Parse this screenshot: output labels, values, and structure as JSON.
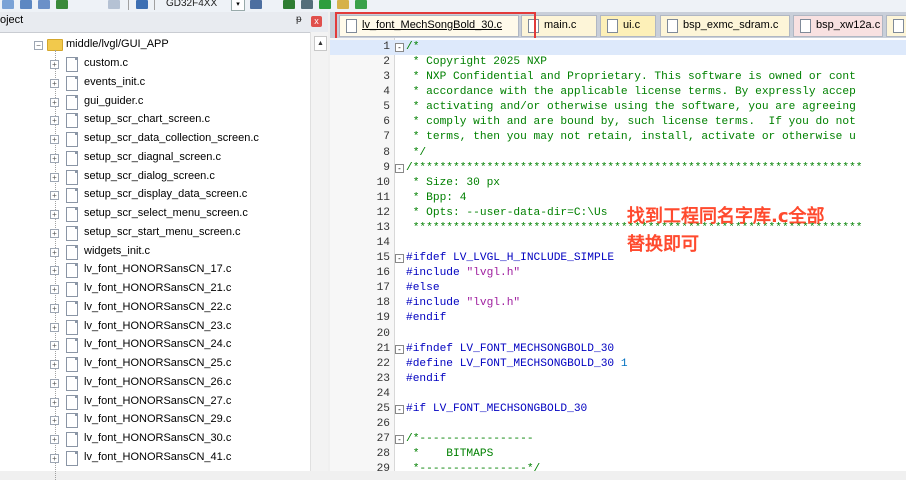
{
  "toolbar": {
    "device_combo": "GD32F4XX",
    "dropdown_arrow": "▾"
  },
  "project": {
    "title": "oject",
    "pin": "ᵽ",
    "close": "x",
    "folder_label": "middle/lvgl/GUI_APP",
    "files": [
      "custom.c",
      "events_init.c",
      "gui_guider.c",
      "setup_scr_chart_screen.c",
      "setup_scr_data_collection_screen.c",
      "setup_scr_diagnal_screen.c",
      "setup_scr_dialog_screen.c",
      "setup_scr_display_data_screen.c",
      "setup_scr_select_menu_screen.c",
      "setup_scr_start_menu_screen.c",
      "widgets_init.c",
      "lv_font_HONORSansCN_17.c",
      "lv_font_HONORSansCN_21.c",
      "lv_font_HONORSansCN_22.c",
      "lv_font_HONORSansCN_23.c",
      "lv_font_HONORSansCN_24.c",
      "lv_font_HONORSansCN_25.c",
      "lv_font_HONORSansCN_26.c",
      "lv_font_HONORSansCN_27.c",
      "lv_font_HONORSansCN_29.c",
      "lv_font_HONORSansCN_30.c",
      "lv_font_HONORSansCN_41.c"
    ]
  },
  "tabs": [
    {
      "label": "lv_font_MechSongBold_30.c",
      "active": true,
      "style": "active"
    },
    {
      "label": "main.c",
      "active": false,
      "style": "plain"
    },
    {
      "label": "ui.c",
      "active": false,
      "style": "yellow"
    },
    {
      "label": "bsp_exmc_sdram.c",
      "active": false,
      "style": "plain"
    },
    {
      "label": "bsp_xw12a.c",
      "active": false,
      "style": "pink"
    }
  ],
  "editor": {
    "lines": [
      {
        "n": "1",
        "fold": "-",
        "kind": "comment",
        "text": "/*"
      },
      {
        "n": "2",
        "fold": "",
        "kind": "comment",
        "text": " * Copyright 2025 NXP"
      },
      {
        "n": "3",
        "fold": "",
        "kind": "comment",
        "text": " * NXP Confidential and Proprietary. This software is owned or cont"
      },
      {
        "n": "4",
        "fold": "",
        "kind": "comment",
        "text": " * accordance with the applicable license terms. By expressly accep"
      },
      {
        "n": "5",
        "fold": "",
        "kind": "comment",
        "text": " * activating and/or otherwise using the software, you are agreeing"
      },
      {
        "n": "6",
        "fold": "",
        "kind": "comment",
        "text": " * comply with and are bound by, such license terms.  If you do not"
      },
      {
        "n": "7",
        "fold": "",
        "kind": "comment",
        "text": " * terms, then you may not retain, install, activate or otherwise u"
      },
      {
        "n": "8",
        "fold": "",
        "kind": "comment",
        "text": " */"
      },
      {
        "n": "9",
        "fold": "-",
        "kind": "comment",
        "text": "/*******************************************************************"
      },
      {
        "n": "10",
        "fold": "",
        "kind": "comment",
        "text": " * Size: 30 px"
      },
      {
        "n": "11",
        "fold": "",
        "kind": "comment",
        "text": " * Bpp: 4"
      },
      {
        "n": "12",
        "fold": "",
        "kind": "comment",
        "text": " * Opts: --user-data-dir=C:\\Us"
      },
      {
        "n": "13",
        "fold": "",
        "kind": "comment",
        "text": " *******************************************************************"
      },
      {
        "n": "14",
        "fold": "",
        "kind": "plain",
        "text": ""
      },
      {
        "n": "15",
        "fold": "-",
        "kind": "pp",
        "text": "#ifdef LV_LVGL_H_INCLUDE_SIMPLE"
      },
      {
        "n": "16",
        "fold": "",
        "kind": "ppstr",
        "text": "#include ",
        "str": "\"lvgl.h\""
      },
      {
        "n": "17",
        "fold": "",
        "kind": "pp",
        "text": "#else"
      },
      {
        "n": "18",
        "fold": "",
        "kind": "ppstr",
        "text": "#include ",
        "str": "\"lvgl.h\""
      },
      {
        "n": "19",
        "fold": "",
        "kind": "pp",
        "text": "#endif"
      },
      {
        "n": "20",
        "fold": "",
        "kind": "plain",
        "text": ""
      },
      {
        "n": "21",
        "fold": "-",
        "kind": "pp",
        "text": "#ifndef LV_FONT_MECHSONGBOLD_30"
      },
      {
        "n": "22",
        "fold": "",
        "kind": "ppnum",
        "text": "#define LV_FONT_MECHSONGBOLD_30 ",
        "num": "1"
      },
      {
        "n": "23",
        "fold": "",
        "kind": "pp",
        "text": "#endif"
      },
      {
        "n": "24",
        "fold": "",
        "kind": "plain",
        "text": ""
      },
      {
        "n": "25",
        "fold": "-",
        "kind": "pp",
        "text": "#if LV_FONT_MECHSONGBOLD_30"
      },
      {
        "n": "26",
        "fold": "",
        "kind": "plain",
        "text": ""
      },
      {
        "n": "27",
        "fold": "-",
        "kind": "comment",
        "text": "/*-----------------"
      },
      {
        "n": "28",
        "fold": "",
        "kind": "comment",
        "text": " *    BITMAPS"
      },
      {
        "n": "29",
        "fold": "",
        "kind": "comment",
        "text": " *----------------*/"
      }
    ]
  },
  "annotation": {
    "line1": "找到工程同名字库.c全部",
    "line2": "替换即可",
    "color": "#ff4a2e"
  },
  "colors": {
    "highlight_box": "#e23b3b",
    "comment": "#008000",
    "preprocessor": "#0000c0"
  }
}
